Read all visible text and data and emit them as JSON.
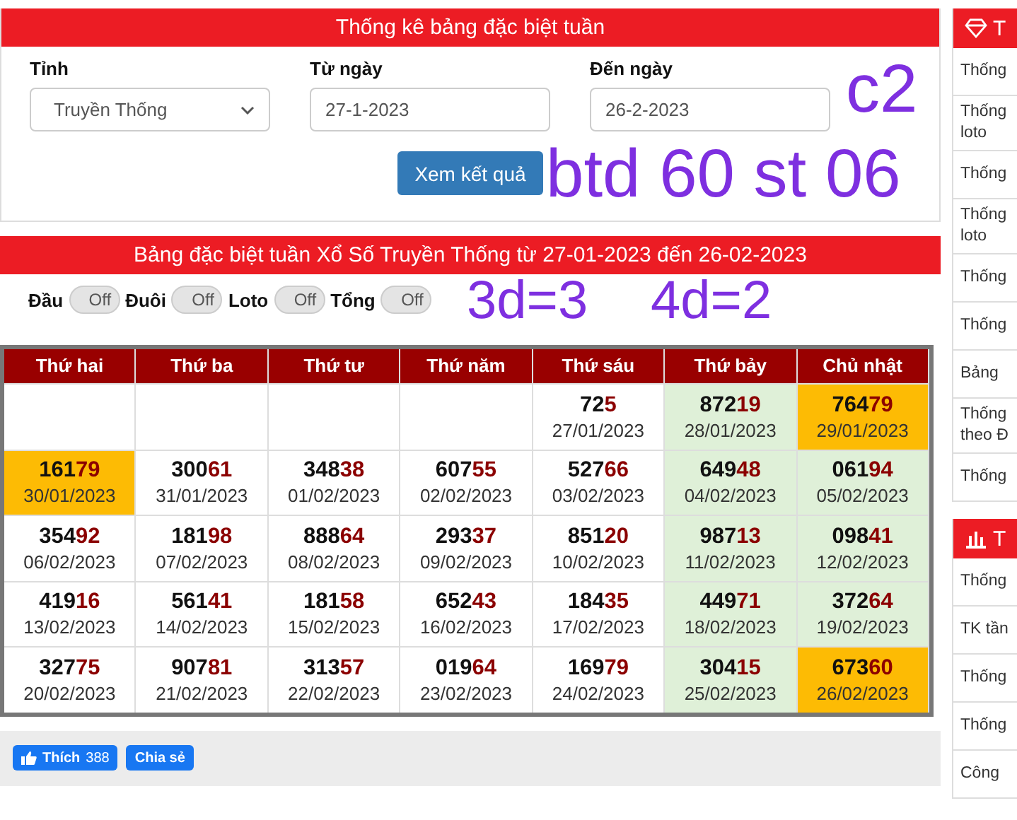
{
  "filter_card": {
    "title": "Thống kê bảng đặc biệt tuần",
    "fields": [
      {
        "kind": "select",
        "label": "Tỉnh",
        "value": "Truyền Thống"
      },
      {
        "kind": "date",
        "label": "Từ ngày",
        "value": "27-1-2023"
      },
      {
        "kind": "date",
        "label": "Đến ngày",
        "value": "26-2-2023"
      }
    ],
    "submit": "Xem kết quả"
  },
  "result_card": {
    "title": "Bảng đặc biệt tuần Xổ Số Truyền Thống từ 27-01-2023 đến 26-02-2023",
    "toggles": [
      {
        "label": "Đầu",
        "state": "Off",
        "on": false
      },
      {
        "label": "Đuôi",
        "state": "Off",
        "on": false
      },
      {
        "label": "Loto",
        "state": "Off",
        "on": false
      },
      {
        "label": "Tổng",
        "state": "Off",
        "on": false
      }
    ],
    "columns": [
      "Thứ hai",
      "Thứ ba",
      "Thứ tư",
      "Thứ năm",
      "Thứ sáu",
      "Thứ bảy",
      "Chủ nhật"
    ],
    "rows": [
      [
        {
          "kind": "empty"
        },
        {
          "kind": "empty"
        },
        {
          "kind": "empty"
        },
        {
          "kind": "empty"
        },
        {
          "kind": "plain",
          "head": "72",
          "tail": "5",
          "date": "27/01/2023"
        },
        {
          "kind": "weekend",
          "head": "872",
          "tail": "19",
          "date": "28/01/2023"
        },
        {
          "kind": "highlight",
          "head": "764",
          "tail": "79",
          "date": "29/01/2023"
        }
      ],
      [
        {
          "kind": "highlight",
          "head": "161",
          "tail": "79",
          "date": "30/01/2023"
        },
        {
          "kind": "plain",
          "head": "300",
          "tail": "61",
          "date": "31/01/2023"
        },
        {
          "kind": "plain",
          "head": "348",
          "tail": "38",
          "date": "01/02/2023"
        },
        {
          "kind": "plain",
          "head": "607",
          "tail": "55",
          "date": "02/02/2023"
        },
        {
          "kind": "plain",
          "head": "527",
          "tail": "66",
          "date": "03/02/2023"
        },
        {
          "kind": "weekend",
          "head": "649",
          "tail": "48",
          "date": "04/02/2023"
        },
        {
          "kind": "weekend",
          "head": "061",
          "tail": "94",
          "date": "05/02/2023"
        }
      ],
      [
        {
          "kind": "plain",
          "head": "354",
          "tail": "92",
          "date": "06/02/2023"
        },
        {
          "kind": "plain",
          "head": "181",
          "tail": "98",
          "date": "07/02/2023"
        },
        {
          "kind": "plain",
          "head": "888",
          "tail": "64",
          "date": "08/02/2023"
        },
        {
          "kind": "plain",
          "head": "293",
          "tail": "37",
          "date": "09/02/2023"
        },
        {
          "kind": "plain",
          "head": "851",
          "tail": "20",
          "date": "10/02/2023"
        },
        {
          "kind": "weekend",
          "head": "987",
          "tail": "13",
          "date": "11/02/2023"
        },
        {
          "kind": "weekend",
          "head": "098",
          "tail": "41",
          "date": "12/02/2023"
        }
      ],
      [
        {
          "kind": "plain",
          "head": "419",
          "tail": "16",
          "date": "13/02/2023"
        },
        {
          "kind": "plain",
          "head": "561",
          "tail": "41",
          "date": "14/02/2023"
        },
        {
          "kind": "plain",
          "head": "181",
          "tail": "58",
          "date": "15/02/2023"
        },
        {
          "kind": "plain",
          "head": "652",
          "tail": "43",
          "date": "16/02/2023"
        },
        {
          "kind": "plain",
          "head": "184",
          "tail": "35",
          "date": "17/02/2023"
        },
        {
          "kind": "weekend",
          "head": "449",
          "tail": "71",
          "date": "18/02/2023"
        },
        {
          "kind": "weekend",
          "head": "372",
          "tail": "64",
          "date": "19/02/2023"
        }
      ],
      [
        {
          "kind": "plain",
          "head": "327",
          "tail": "75",
          "date": "20/02/2023"
        },
        {
          "kind": "plain",
          "head": "907",
          "tail": "81",
          "date": "21/02/2023"
        },
        {
          "kind": "plain",
          "head": "313",
          "tail": "57",
          "date": "22/02/2023"
        },
        {
          "kind": "plain",
          "head": "019",
          "tail": "64",
          "date": "23/02/2023"
        },
        {
          "kind": "plain",
          "head": "169",
          "tail": "79",
          "date": "24/02/2023"
        },
        {
          "kind": "weekend",
          "head": "304",
          "tail": "15",
          "date": "25/02/2023"
        },
        {
          "kind": "highlight",
          "head": "673",
          "tail": "60",
          "date": "26/02/2023"
        }
      ]
    ]
  },
  "social": {
    "like": "Thích",
    "like_count": "388",
    "share": "Chia sẻ"
  },
  "sidebar": [
    {
      "title": "T",
      "items": [
        "Thống",
        "Thống loto",
        "Thống",
        "Thống loto",
        "Thống",
        "Thống",
        "Bảng",
        "Thống theo Đ",
        "Thống"
      ]
    },
    {
      "title": "T",
      "items": [
        "Thống",
        "TK tần",
        "Thống",
        "Thống",
        "Công"
      ]
    }
  ],
  "annotations": [
    {
      "text": "c2"
    },
    {
      "text": "btd 60 st 06"
    },
    {
      "text": "3d=3"
    },
    {
      "text": "4d=2"
    }
  ]
}
